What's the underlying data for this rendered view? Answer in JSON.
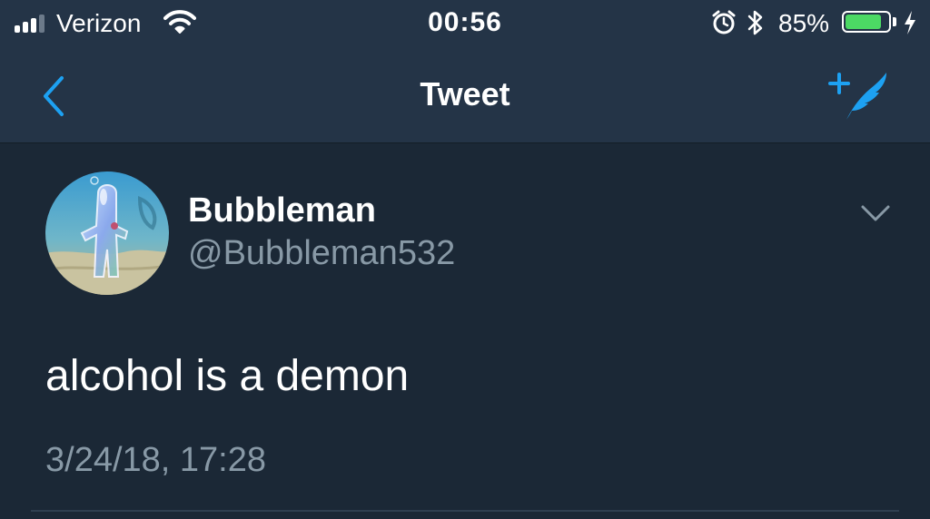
{
  "status_bar": {
    "carrier": "Verizon",
    "time": "00:56",
    "battery_percent": "85%",
    "battery_level": 0.85,
    "signal_bars_filled": 3,
    "signal_bars_total": 4,
    "icons": [
      "signal-icon",
      "wifi-icon",
      "alarm-icon",
      "bluetooth-icon",
      "battery-icon",
      "charging-bolt-icon"
    ]
  },
  "nav": {
    "title": "Tweet",
    "back_icon": "chevron-left-icon",
    "compose_icon": "compose-tweet-icon"
  },
  "tweet": {
    "display_name": "Bubbleman",
    "handle": "@Bubbleman532",
    "text": "alcohol is a demon",
    "timestamp": "3/24/18, 17:28",
    "menu_icon": "chevron-down-icon"
  },
  "colors": {
    "background": "#1b2836",
    "bar_background": "#243447",
    "accent": "#1da1f2",
    "secondary_text": "#8899a6",
    "battery_fill": "#4cd964"
  }
}
